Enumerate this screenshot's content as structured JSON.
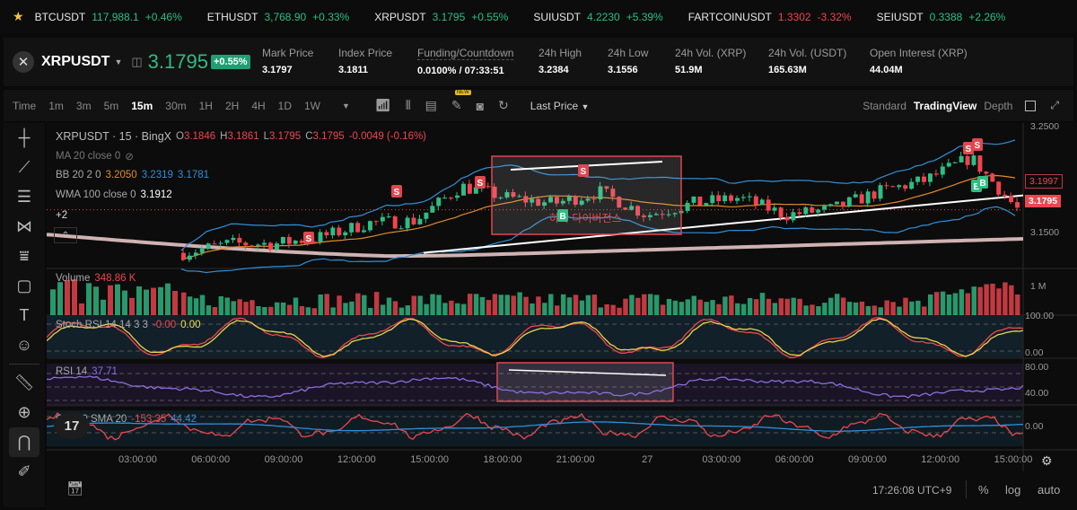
{
  "ticker": [
    {
      "symbol": "BTCUSDT",
      "price": "117,988.1",
      "change": "+0.46%",
      "dir": "up"
    },
    {
      "symbol": "ETHUSDT",
      "price": "3,768.90",
      "change": "+0.33%",
      "dir": "up"
    },
    {
      "symbol": "XRPUSDT",
      "price": "3.1795",
      "change": "+0.55%",
      "dir": "up"
    },
    {
      "symbol": "SUIUSDT",
      "price": "4.2230",
      "change": "+5.39%",
      "dir": "up"
    },
    {
      "symbol": "FARTCOINUSDT",
      "price": "1.3302",
      "change": "-3.32%",
      "dir": "dn"
    },
    {
      "symbol": "SEIUSDT",
      "price": "0.3388",
      "change": "+2.26%",
      "dir": "up"
    }
  ],
  "header": {
    "symbol": "XRPUSDT",
    "last_price": "3.1795",
    "change": "+0.55%",
    "stats": [
      {
        "label": "Mark Price",
        "value": "3.1797"
      },
      {
        "label": "Index Price",
        "value": "3.1811"
      },
      {
        "label": "Funding/Countdown",
        "value": "0.0100% / 07:33:51"
      },
      {
        "label": "24h High",
        "value": "3.2384"
      },
      {
        "label": "24h Low",
        "value": "3.1556"
      },
      {
        "label": "24h Vol. (XRP)",
        "value": "51.9M"
      },
      {
        "label": "24h Vol. (USDT)",
        "value": "165.63M"
      },
      {
        "label": "Open Interest (XRP)",
        "value": "44.04M"
      }
    ]
  },
  "toolbar": {
    "timeframes": [
      "Time",
      "1m",
      "3m",
      "5m",
      "15m",
      "30m",
      "1H",
      "2H",
      "4H",
      "1D",
      "1W"
    ],
    "active_timeframe": "15m",
    "new_badge": "NEW",
    "price_type": "Last Price",
    "views": [
      "Standard",
      "TradingView",
      "Depth"
    ],
    "active_view": "TradingView"
  },
  "legend": {
    "title": "XRPUSDT · 15 · BingX",
    "o": "3.1846",
    "h": "3.1861",
    "l": "3.1795",
    "c": "3.1795",
    "chg": "-0.0049 (-0.16%)",
    "ma": "MA 20 close 0",
    "bb": "BB 20 2 0",
    "bb_basis": "3.2050",
    "bb_upper": "3.2319",
    "bb_lower": "3.1781",
    "wma": "WMA 100 close 0",
    "wma_val": "3.1912",
    "more": "+2"
  },
  "annotation": {
    "text": "하락 다이버전스"
  },
  "panes": {
    "volume": {
      "label": "Volume",
      "value": "348.86 K",
      "axis": "1 M"
    },
    "stoch": {
      "label": "Stoch RSI 14 14 3 3",
      "k": "-0.00",
      "d": "0.00",
      "axis": [
        "100.00",
        "0.00"
      ]
    },
    "rsi": {
      "label": "RSI 14",
      "value": "37.71",
      "axis": [
        "80.00",
        "40.00"
      ]
    },
    "cci": {
      "label": "CCI 20 SMA 20",
      "value": "-153.35",
      "sma": "44.42",
      "axis": "0.00"
    }
  },
  "price_axis": {
    "ticks": [
      "3.2500",
      "3.1500"
    ],
    "tag_prev": "3.1997",
    "tag_last": "3.1795"
  },
  "time_axis": [
    "03:00:00",
    "06:00:00",
    "09:00:00",
    "12:00:00",
    "15:00:00",
    "18:00:00",
    "21:00:00",
    "27",
    "03:00:00",
    "06:00:00",
    "09:00:00",
    "12:00:00",
    "15:00:00"
  ],
  "status": {
    "clock": "17:26:08 UTC+9",
    "percent": "%",
    "log": "log",
    "auto": "auto"
  },
  "colors": {
    "up": "#2ebd85",
    "down": "#f0454f",
    "bb": "#2f8fd8",
    "ma": "#e08a2a",
    "wma": "#f3d0d0"
  },
  "chart_data": {
    "type": "candlestick",
    "price_path": [
      3.142,
      3.15,
      3.15,
      3.156,
      3.168,
      3.17,
      3.2,
      3.19,
      3.185,
      3.195,
      3.175,
      3.185,
      3.19,
      3.175,
      3.18,
      3.195,
      3.205,
      3.225,
      3.18
    ],
    "ylim": [
      3.13,
      3.255
    ]
  }
}
